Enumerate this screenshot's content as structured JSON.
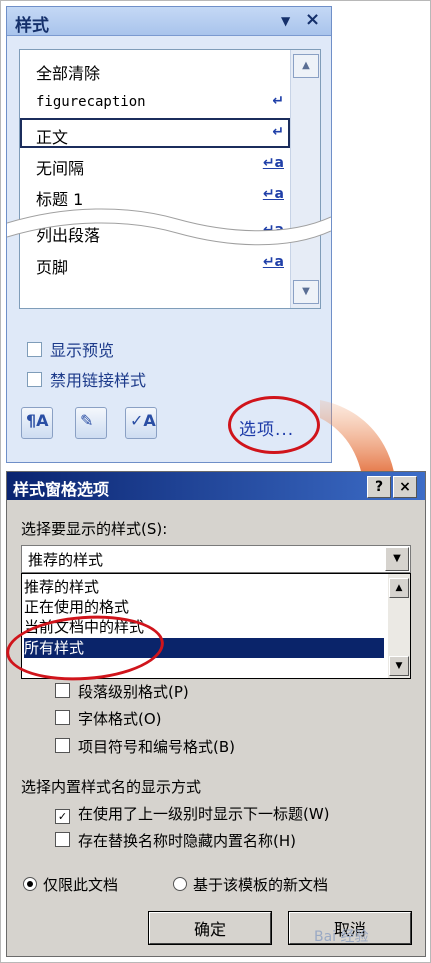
{
  "styles_pane": {
    "title": "样式",
    "dropdown_glyph": "▼",
    "close_glyph": "×",
    "items": [
      {
        "label": "全部清除",
        "symbol": ""
      },
      {
        "label": "figurecaption",
        "symbol": "↵"
      },
      {
        "label": "正文",
        "symbol": "↵"
      },
      {
        "label": "无间隔",
        "symbol": "↵a"
      },
      {
        "label": "标题 1",
        "symbol": "↵a"
      },
      {
        "label": "列出段落",
        "symbol": "↵a"
      },
      {
        "label": "页脚",
        "symbol": "↵a"
      }
    ],
    "selected_item": "正文",
    "show_preview_label": "显示预览",
    "disable_linked_label": "禁用链接样式",
    "options_link": "选项...",
    "tool_icons": [
      "new-style-icon",
      "style-inspector-icon",
      "manage-styles-icon"
    ]
  },
  "dialog": {
    "title": "样式窗格选项",
    "help_glyph": "?",
    "close_glyph": "×",
    "select_label": "选择要显示的样式(S):",
    "combo_value": "推荐的样式",
    "dropdown_options": [
      "推荐的样式",
      "正在使用的格式",
      "当前文档中的样式",
      "所有样式"
    ],
    "selected_option": "所有样式",
    "format_checks": [
      {
        "label": "段落级别格式(P)",
        "checked": false
      },
      {
        "label": "字体格式(O)",
        "checked": false
      },
      {
        "label": "项目符号和编号格式(B)",
        "checked": false
      }
    ],
    "builtin_label": "选择内置样式名的显示方式",
    "builtin_checks": [
      {
        "label": "在使用了上一级别时显示下一标题(W)",
        "checked": true
      },
      {
        "label": "存在替换名称时隐藏内置名称(H)",
        "checked": false
      }
    ],
    "scope_radios": [
      {
        "label": "仅限此文档",
        "selected": true
      },
      {
        "label": "基于该模板的新文档",
        "selected": false
      }
    ],
    "ok_label": "确定",
    "cancel_label": "取消"
  },
  "colors": {
    "highlight_circle": "#d0141b",
    "arrow": "#d9481c",
    "selection": "#0a246a"
  },
  "watermark": "Bai 经验"
}
